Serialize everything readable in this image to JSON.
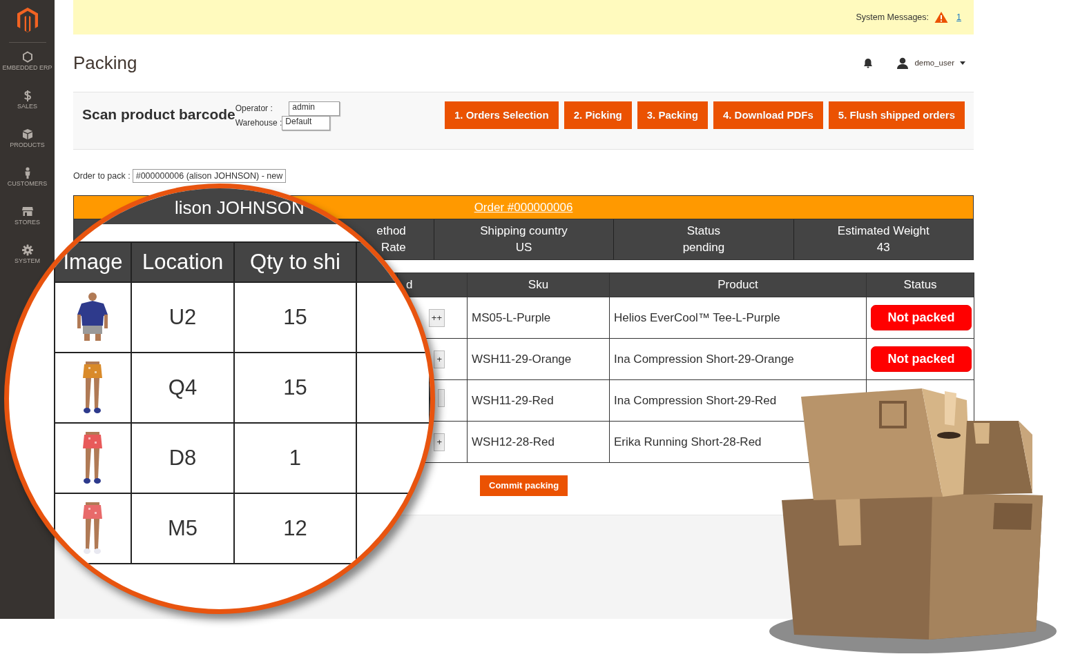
{
  "sidebar": {
    "items": [
      {
        "kind": "hexagon",
        "label": "EMBEDDED ERP"
      },
      {
        "kind": "dollar",
        "label": "SALES"
      },
      {
        "kind": "box",
        "label": "PRODUCTS"
      },
      {
        "kind": "person",
        "label": "CUSTOMERS"
      },
      {
        "kind": "store",
        "label": "STORES"
      },
      {
        "kind": "gear",
        "label": "SYSTEM"
      }
    ]
  },
  "system_messages": {
    "label": "System Messages:",
    "count": "1"
  },
  "page_title": "Packing",
  "user": {
    "name": "demo_user"
  },
  "scan": {
    "title": "Scan product barcode",
    "operator_label": "Operator :",
    "operator": "admin",
    "warehouse_label": "Warehouse :",
    "warehouse": "Default"
  },
  "steps": [
    "1. Orders Selection",
    "2. Picking",
    "3. Packing",
    "4. Download PDFs",
    "5. Flush shipped orders"
  ],
  "order_select": {
    "label": "Order to pack :",
    "value": "#000000006 (alison JOHNSON) - new"
  },
  "order": {
    "title": "Order #000000006",
    "info": [
      {
        "lines": [
          "ethod",
          "Rate"
        ]
      },
      {
        "lines": [
          "Shipping country",
          "US"
        ]
      },
      {
        "lines": [
          "Status",
          "pending"
        ]
      },
      {
        "lines": [
          "Estimated Weight",
          "43"
        ]
      }
    ]
  },
  "items": {
    "columns": [
      "d",
      "Sku",
      "Product",
      "Status"
    ],
    "rows": [
      {
        "button": "++",
        "sku": "MS05-L-Purple",
        "product": "Helios EverCool™ Tee-L-Purple",
        "status": "Not packed"
      },
      {
        "button": "+",
        "sku": "WSH11-29-Orange",
        "product": "Ina Compression Short-29-Orange",
        "status": "Not packed"
      },
      {
        "sku": "WSH11-29-Red",
        "product": "Ina Compression Short-29-Red"
      },
      {
        "button": "+",
        "sku": "WSH12-28-Red",
        "product": "Erika Running Short-28-Red"
      }
    ]
  },
  "commit_button": "Commit packing",
  "magnifier": {
    "customer": "lison JOHNSON",
    "columns": [
      "Image",
      "Location",
      "Qty to shi"
    ],
    "rows": [
      {
        "location": "U2",
        "qty": "15"
      },
      {
        "location": "Q4",
        "qty": "15"
      },
      {
        "location": "D8",
        "qty": "1"
      },
      {
        "location": "M5",
        "qty": "12"
      }
    ]
  }
}
